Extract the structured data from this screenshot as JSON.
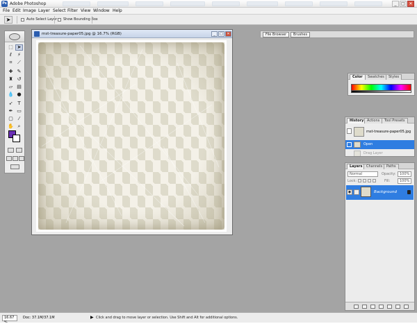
{
  "app": {
    "title": "Adobe Photoshop",
    "icon": "photoshop-logo-icon"
  },
  "window_controls": {
    "minimize": "_",
    "maximize": "□",
    "close": "✕"
  },
  "menu": [
    "File",
    "Edit",
    "Image",
    "Layer",
    "Select",
    "Filter",
    "View",
    "Window",
    "Help"
  ],
  "options_bar": {
    "tool_icon": "move-tool-icon",
    "auto_select_label": "Auto Select Layer",
    "show_bounding_label": "Show Bounding Box",
    "palette_well_tabs": [
      "File Browser",
      "Brushes"
    ]
  },
  "toolbox": {
    "foreground_color": "#6a2fb5",
    "background_color": "#ffffff",
    "tools": [
      "marquee-tool-icon",
      "move-tool-icon",
      "lasso-tool-icon",
      "magic-wand-tool-icon",
      "crop-tool-icon",
      "slice-tool-icon",
      "healing-brush-tool-icon",
      "brush-tool-icon",
      "clone-stamp-tool-icon",
      "history-brush-tool-icon",
      "eraser-tool-icon",
      "gradient-tool-icon",
      "blur-tool-icon",
      "dodge-tool-icon",
      "path-selection-tool-icon",
      "type-tool-icon",
      "pen-tool-icon",
      "shape-tool-icon",
      "notes-tool-icon",
      "eyedropper-tool-icon",
      "hand-tool-icon",
      "zoom-tool-icon"
    ]
  },
  "document": {
    "title": "mst-treasure-paper05.jpg @ 16.7% (RGB)"
  },
  "color_panel": {
    "tabs": [
      "Color",
      "Swatches",
      "Styles"
    ]
  },
  "history_panel": {
    "tabs": [
      "History",
      "Actions",
      "Tool Presets"
    ],
    "snapshot": "mst-treasure-paper05.jpg",
    "states": [
      "Open",
      "Drag Layer"
    ]
  },
  "layers_panel": {
    "tabs": [
      "Layers",
      "Channels",
      "Paths"
    ],
    "blend_mode": "Normal",
    "opacity_label": "Opacity:",
    "opacity_value": "100%",
    "lock_label": "Lock:",
    "fill_label": "Fill:",
    "fill_value": "100%",
    "layers": [
      {
        "name": "Background",
        "visible": true,
        "locked": true
      }
    ]
  },
  "status_bar": {
    "zoom": "16.67 %",
    "doc_size": "Doc: 37.1M/37.1M",
    "message": "Click and drag to move layer or selection. Use Shift and Alt for additional options."
  },
  "colors": {
    "selection_blue": "#2f7de1",
    "workspace_gray": "#a4a4a4",
    "paper_tone": "#dedbcb"
  }
}
